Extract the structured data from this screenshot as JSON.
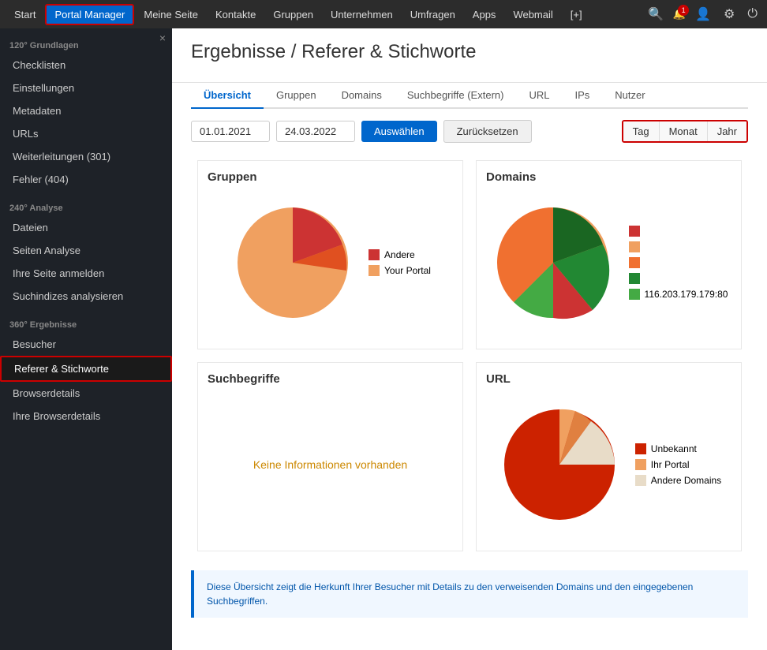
{
  "topNav": {
    "items": [
      {
        "label": "Start",
        "active": false,
        "highlighted": false
      },
      {
        "label": "Portal Manager",
        "active": false,
        "highlighted": true
      },
      {
        "label": "Meine Seite",
        "active": false,
        "highlighted": false
      },
      {
        "label": "Kontakte",
        "active": false,
        "highlighted": false
      },
      {
        "label": "Gruppen",
        "active": false,
        "highlighted": false
      },
      {
        "label": "Unternehmen",
        "active": false,
        "highlighted": false
      },
      {
        "label": "Umfragen",
        "active": false,
        "highlighted": false
      },
      {
        "label": "Apps",
        "active": false,
        "highlighted": false
      },
      {
        "label": "Webmail",
        "active": false,
        "highlighted": false
      },
      {
        "label": "[+]",
        "active": false,
        "highlighted": false
      }
    ],
    "notificationCount": "1"
  },
  "sidebar": {
    "close": "×",
    "sections": [
      {
        "title": "120° Grundlagen",
        "items": [
          {
            "label": "Checklisten",
            "active": false
          },
          {
            "label": "Einstellungen",
            "active": false
          },
          {
            "label": "Metadaten",
            "active": false
          },
          {
            "label": "URLs",
            "active": false
          },
          {
            "label": "Weiterleitungen (301)",
            "active": false
          },
          {
            "label": "Fehler (404)",
            "active": false
          }
        ]
      },
      {
        "title": "240° Analyse",
        "items": [
          {
            "label": "Dateien",
            "active": false
          },
          {
            "label": "Seiten Analyse",
            "active": false
          },
          {
            "label": "Ihre Seite anmelden",
            "active": false
          },
          {
            "label": "Suchindizes analysieren",
            "active": false
          }
        ]
      },
      {
        "title": "360° Ergebnisse",
        "items": [
          {
            "label": "Besucher",
            "active": false
          },
          {
            "label": "Referer & Stichworte",
            "active": true
          },
          {
            "label": "Browserdetails",
            "active": false
          },
          {
            "label": "Ihre Browserdetails",
            "active": false
          }
        ]
      }
    ]
  },
  "page": {
    "title": "Ergebnisse / Referer & Stichworte",
    "tabs": [
      {
        "label": "Übersicht",
        "active": true
      },
      {
        "label": "Gruppen",
        "active": false
      },
      {
        "label": "Domains",
        "active": false
      },
      {
        "label": "Suchbegriffe (Extern)",
        "active": false
      },
      {
        "label": "URL",
        "active": false
      },
      {
        "label": "IPs",
        "active": false
      },
      {
        "label": "Nutzer",
        "active": false
      }
    ],
    "filter": {
      "dateFrom": "01.01.2021",
      "dateTo": "24.03.2022",
      "selectBtn": "Auswählen",
      "resetBtn": "Zurücksetzen",
      "periods": [
        "Tag",
        "Monat",
        "Jahr"
      ]
    },
    "charts": {
      "gruppen": {
        "title": "Gruppen",
        "legend": [
          {
            "label": "Andere",
            "color": "#cc3333"
          },
          {
            "label": "Your Portal",
            "color": "#f0a060"
          }
        ]
      },
      "domains": {
        "title": "Domains",
        "legend": [
          {
            "label": "",
            "color": "#cc3333"
          },
          {
            "label": "",
            "color": "#f0a060"
          },
          {
            "label": "",
            "color": "#f0a060"
          },
          {
            "label": "",
            "color": "#228833"
          },
          {
            "label": "116.203.179.179:80",
            "color": "#44aa44"
          }
        ]
      },
      "suchbegriffe": {
        "title": "Suchbegriffe",
        "noData": "Keine Informationen vorhanden"
      },
      "url": {
        "title": "URL",
        "legend": [
          {
            "label": "Unbekannt",
            "color": "#cc2200"
          },
          {
            "label": "Ihr Portal",
            "color": "#f0a060"
          },
          {
            "label": "Andere Domains",
            "color": "#e8e0d0"
          }
        ]
      }
    },
    "infoText": "Diese Übersicht zeigt die Herkunft Ihrer Besucher mit Details zu den verweisenden Domains und den eingegebenen Suchbegriffen."
  }
}
